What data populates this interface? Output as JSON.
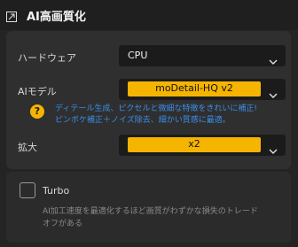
{
  "header": {
    "icon": "collapse-icon",
    "title": "AI高画質化"
  },
  "hardware": {
    "label": "ハードウェア",
    "value": "CPU"
  },
  "ai_model": {
    "label": "AIモデル",
    "value": "moDetail-HQ  v2",
    "description_line1": "ディテール生成、ピクセルと微細な特徴をきれいに補正!",
    "description_line2": "ピンボケ補正＋ノイズ除去、細かい質感に最適。"
  },
  "scale": {
    "label": "拡大",
    "value": "x2"
  },
  "turbo": {
    "label": "Turbo",
    "checked": false,
    "description_line1": "AI加工速度を最適化するほど画質がわずかな損失のトレード",
    "description_line2": "オフがある"
  },
  "colors": {
    "accent": "#f5b400",
    "link": "#3b8ee8",
    "background": "#242424",
    "section": "#2f2f2f"
  }
}
